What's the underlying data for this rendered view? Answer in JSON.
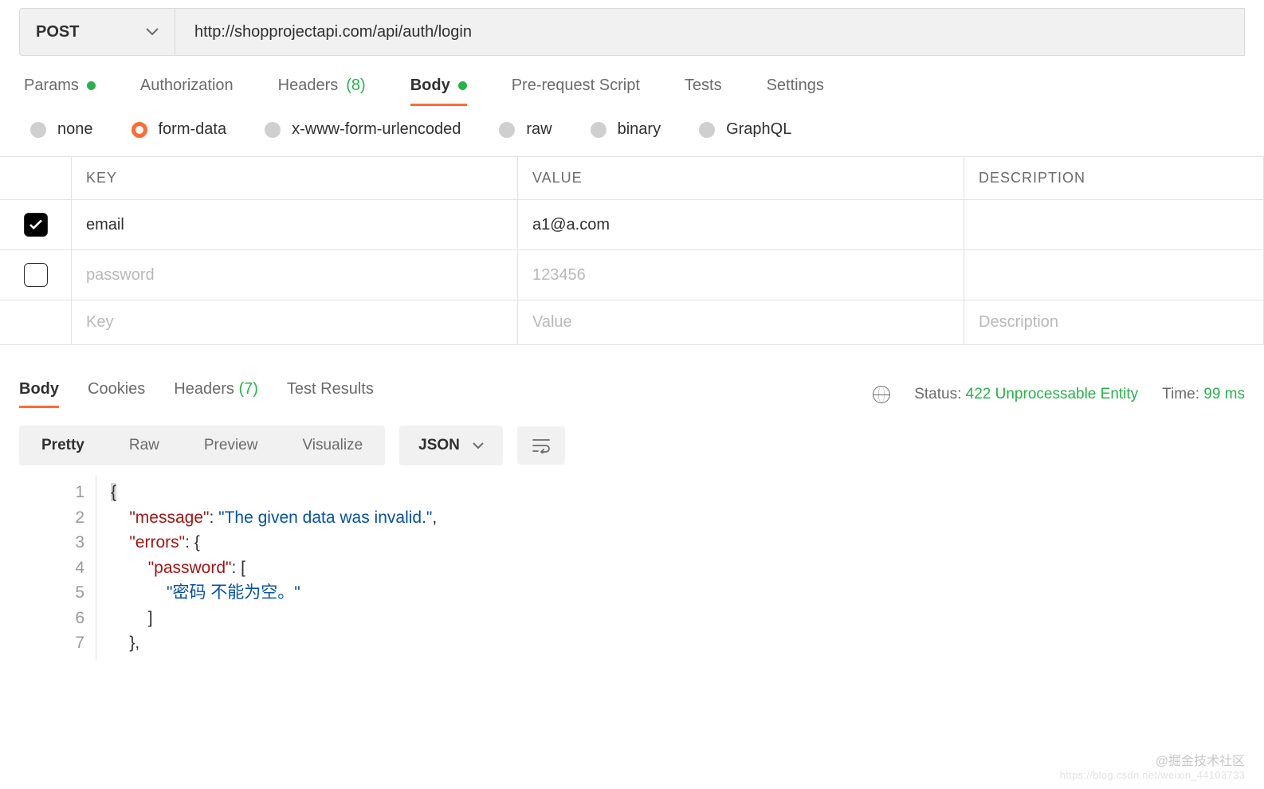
{
  "request": {
    "method": "POST",
    "url": "http://shopprojectapi.com/api/auth/login",
    "tabs": [
      {
        "label": "Params",
        "dot": true
      },
      {
        "label": "Authorization"
      },
      {
        "label": "Headers",
        "count": "(8)"
      },
      {
        "label": "Body",
        "dot": true,
        "active": true
      },
      {
        "label": "Pre-request Script"
      },
      {
        "label": "Tests"
      },
      {
        "label": "Settings"
      }
    ],
    "body_types": [
      {
        "label": "none"
      },
      {
        "label": "form-data",
        "selected": true
      },
      {
        "label": "x-www-form-urlencoded"
      },
      {
        "label": "raw"
      },
      {
        "label": "binary"
      },
      {
        "label": "GraphQL"
      }
    ],
    "form_data": {
      "headers": {
        "key": "KEY",
        "value": "VALUE",
        "desc": "DESCRIPTION"
      },
      "rows": [
        {
          "checked": true,
          "key": "email",
          "value": "a1@a.com"
        },
        {
          "checked": false,
          "key": "password",
          "value": "123456"
        }
      ],
      "placeholders": {
        "key": "Key",
        "value": "Value",
        "desc": "Description"
      }
    }
  },
  "response": {
    "tabs": [
      {
        "label": "Body",
        "active": true
      },
      {
        "label": "Cookies"
      },
      {
        "label": "Headers",
        "count": "(7)"
      },
      {
        "label": "Test Results"
      }
    ],
    "status_label": "Status:",
    "status_value": "422 Unprocessable Entity",
    "time_label": "Time:",
    "time_value": "99 ms",
    "view_modes": [
      {
        "label": "Pretty",
        "active": true
      },
      {
        "label": "Raw"
      },
      {
        "label": "Preview"
      },
      {
        "label": "Visualize"
      }
    ],
    "format": "JSON",
    "code_lines": [
      "{",
      "    \"message\": \"The given data was invalid.\",",
      "    \"errors\": {",
      "        \"password\": [",
      "            \"密码 不能为空。\"",
      "        ]",
      "    },"
    ]
  },
  "watermark": {
    "l1": "@掘金技术社区",
    "l2": "https://blog.csdn.net/weixin_44103733"
  }
}
